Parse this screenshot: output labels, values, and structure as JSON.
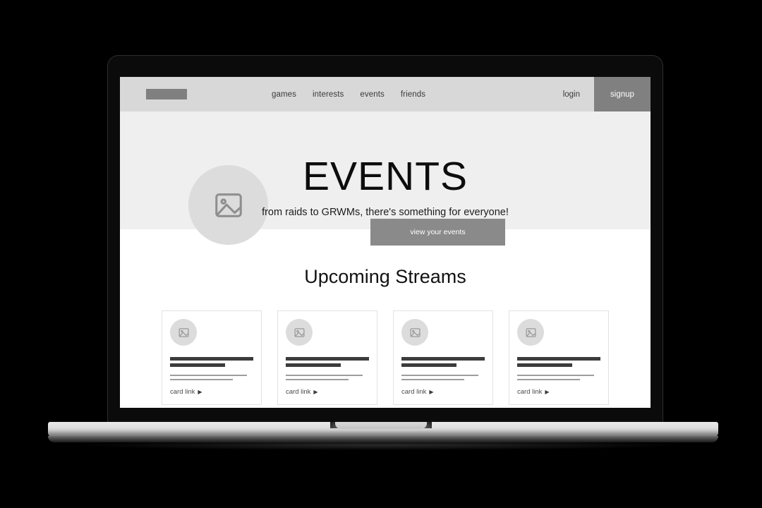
{
  "device": {
    "type": "laptop-mockup",
    "frame_color": "#0b0b0b",
    "base_color": "#dedede"
  },
  "theme": {
    "nav_bg": "#d8d8d8",
    "hero_bg": "#efefef",
    "page_bg": "#ffffff",
    "accent_gray": "#808080",
    "cta_gray": "#8a8a8a",
    "placeholder_gray": "#dcdcdc",
    "line_dark": "#3c3c3c",
    "line_light": "#9d9d9d"
  },
  "navbar": {
    "logo_label": "",
    "links": [
      {
        "label": "games"
      },
      {
        "label": "interests"
      },
      {
        "label": "events"
      },
      {
        "label": "friends"
      }
    ],
    "login_label": "login",
    "signup_label": "signup"
  },
  "hero": {
    "image_icon": "image-placeholder-icon",
    "title": "EVENTS",
    "subtitle": "from raids to GRWMs, there's something for everyone!",
    "cta_label": "view your events"
  },
  "streams": {
    "heading": "Upcoming Streams",
    "cards": [
      {
        "thumb_icon": "image-placeholder-icon",
        "link_label": "card link",
        "link_arrow": "▶"
      },
      {
        "thumb_icon": "image-placeholder-icon",
        "link_label": "card link",
        "link_arrow": "▶"
      },
      {
        "thumb_icon": "image-placeholder-icon",
        "link_label": "card link",
        "link_arrow": "▶"
      },
      {
        "thumb_icon": "image-placeholder-icon",
        "link_label": "card link",
        "link_arrow": "▶"
      }
    ]
  }
}
